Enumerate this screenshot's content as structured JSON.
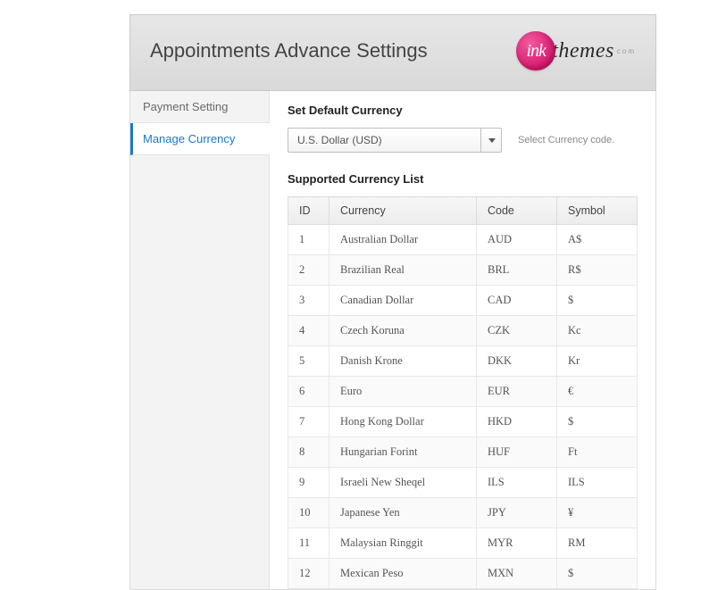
{
  "header": {
    "title": "Appointments Advance Settings",
    "logo_circle": "ink",
    "logo_text": "themes",
    "logo_suffix": "com"
  },
  "sidebar": {
    "items": [
      {
        "label": "Payment Setting",
        "active": false
      },
      {
        "label": "Manage Currency",
        "active": true
      }
    ]
  },
  "main": {
    "default_currency_label": "Set Default Currency",
    "select_value": "U.S. Dollar   (USD)",
    "select_helper": "Select Currency code.",
    "supported_list_label": "Supported Currency List",
    "table": {
      "headers": {
        "id": "ID",
        "currency": "Currency",
        "code": "Code",
        "symbol": "Symbol"
      },
      "rows": [
        {
          "id": "1",
          "currency": "Australian Dollar",
          "code": "AUD",
          "symbol": "A$"
        },
        {
          "id": "2",
          "currency": "Brazilian Real",
          "code": "BRL",
          "symbol": "R$"
        },
        {
          "id": "3",
          "currency": "Canadian Dollar",
          "code": "CAD",
          "symbol": "$"
        },
        {
          "id": "4",
          "currency": "Czech Koruna",
          "code": "CZK",
          "symbol": "Kc"
        },
        {
          "id": "5",
          "currency": "Danish Krone",
          "code": "DKK",
          "symbol": "Kr"
        },
        {
          "id": "6",
          "currency": "Euro",
          "code": "EUR",
          "symbol": "€"
        },
        {
          "id": "7",
          "currency": "Hong Kong Dollar",
          "code": "HKD",
          "symbol": "$"
        },
        {
          "id": "8",
          "currency": "Hungarian Forint",
          "code": "HUF",
          "symbol": "Ft"
        },
        {
          "id": "9",
          "currency": "Israeli New Sheqel",
          "code": "ILS",
          "symbol": "ILS"
        },
        {
          "id": "10",
          "currency": "Japanese Yen",
          "code": "JPY",
          "symbol": "¥"
        },
        {
          "id": "11",
          "currency": "Malaysian Ringgit",
          "code": "MYR",
          "symbol": "RM"
        },
        {
          "id": "12",
          "currency": "Mexican Peso",
          "code": "MXN",
          "symbol": "$"
        }
      ]
    }
  }
}
